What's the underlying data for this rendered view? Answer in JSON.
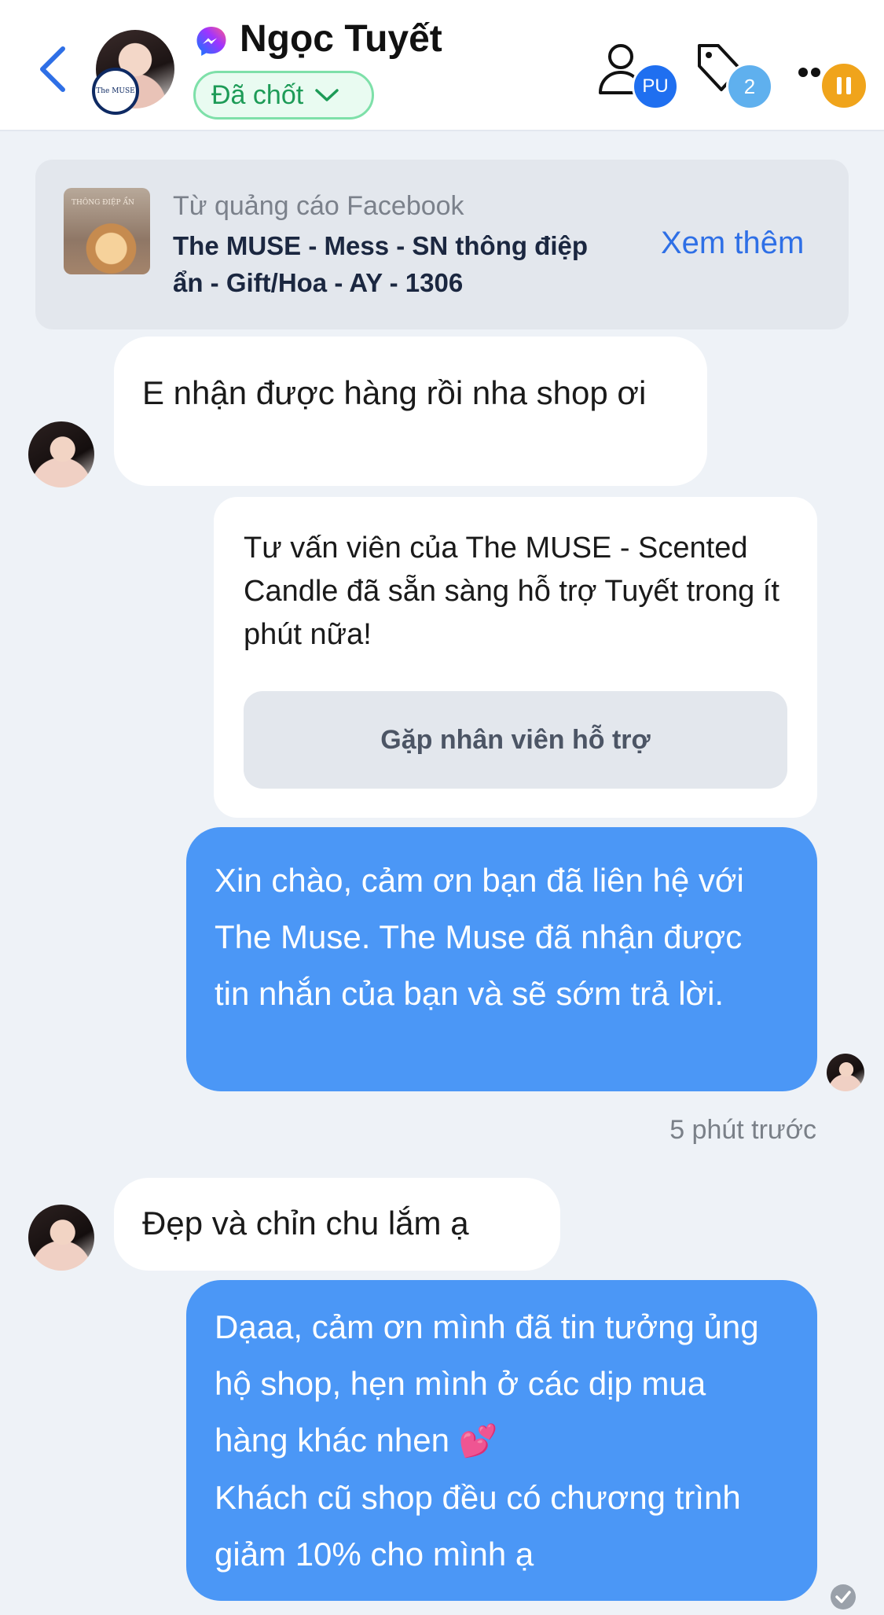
{
  "header": {
    "contact_name": "Ngọc Tuyết",
    "status_label": "Đã chốt",
    "assignee_badge": "PU",
    "tag_count": "2",
    "avatar_logo_text": "The MUSE"
  },
  "ad": {
    "source": "Từ quảng cáo Facebook",
    "title": "The MUSE - Mess - SN thông điệp ẩn - Gift/Hoa - AY - 1306",
    "see_more": "Xem thêm",
    "thumb_text": "THÔNG ĐIỆP ẨN"
  },
  "messages": [
    {
      "direction": "in",
      "text": "E nhận được hàng rồi nha shop ơi"
    },
    {
      "direction": "bot",
      "text": "Tư vấn viên của The MUSE - Scented Candle đã sẵn sàng hỗ trợ Tuyết trong ít phút nữa!",
      "button": "Gặp nhân viên hỗ trợ"
    },
    {
      "direction": "out",
      "text": "Xin chào, cảm ơn bạn đã liên hệ với The Muse. The Muse đã nhận được tin nhắn của bạn và sẽ sớm trả lời."
    },
    {
      "direction": "in",
      "text": "Đẹp và chỉn chu lắm ạ"
    },
    {
      "direction": "out",
      "text_line1": "Dạaa, cảm ơn mình đã tin tưởng ủng hộ shop, hẹn mình ở các dịp mua hàng khác nhen",
      "emoji": "💕",
      "text_line2": "Khách cũ shop đều có chương trình giảm 10% cho mình ạ"
    }
  ],
  "timestamp": "5 phút trước",
  "colors": {
    "accent": "#2e6fe6",
    "outgoing_bubble": "#4b97f6",
    "status_green": "#1d9b57",
    "pause_orange": "#f0a41b"
  }
}
